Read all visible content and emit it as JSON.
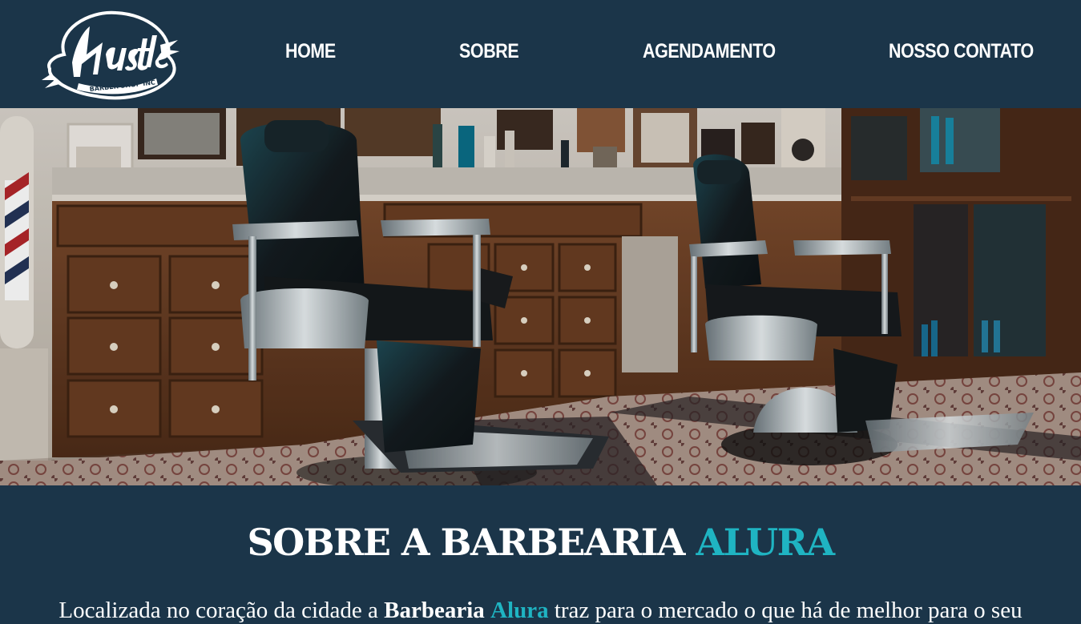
{
  "header": {
    "logo": {
      "name": "Hustle",
      "tagline": "BARBER SHOP INC"
    },
    "nav": [
      {
        "label": "HOME"
      },
      {
        "label": "SOBRE"
      },
      {
        "label": "AGENDAMENTO"
      },
      {
        "label": "NOSSO CONTATO"
      }
    ]
  },
  "hero": {
    "image": "barber-shop-interior-photo"
  },
  "sobre": {
    "title_main": "SOBRE A BARBEARIA ",
    "title_accent": "ALURA",
    "text_before": "Localizada no coração da cidade a ",
    "text_brand_bold": "Barbearia",
    "text_brand_space": " ",
    "text_brand_accent": "Alura",
    "text_after": " traz para o mercado o que há de melhor para o seu"
  },
  "colors": {
    "background": "#1b3549",
    "accent": "#1fb4c2",
    "text": "#ffffff"
  }
}
